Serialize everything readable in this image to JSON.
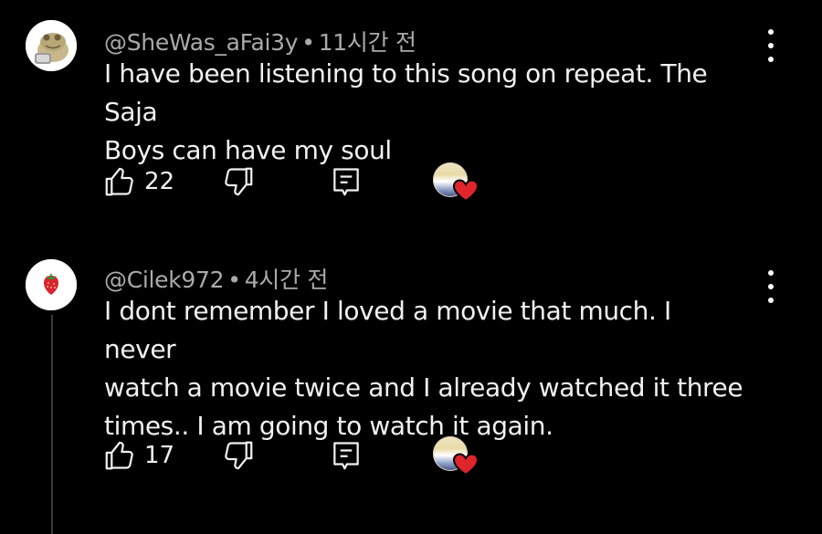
{
  "comments": [
    {
      "handle": "@SheWas_aFai3y",
      "separator": "•",
      "time": "11시간 전",
      "text_lines": [
        "I have been listening to this song on repeat. The Saja",
        "Boys can have my soul"
      ],
      "like_count": "22",
      "avatar_icon": "frog-avatar-icon"
    },
    {
      "handle": "@Cilek972",
      "separator": "•",
      "time": "4시간 전",
      "text_lines": [
        "I dont remember I loved a movie that much. I never",
        "watch a movie twice and I already watched it three",
        "times.. I am going to watch it again."
      ],
      "like_count": "17",
      "avatar_icon": "strawberry-avatar-icon"
    }
  ],
  "colors": {
    "background": "#000000",
    "text": "#f1f1f1",
    "meta": "#aaaaaa",
    "heart": "#e0242c"
  }
}
